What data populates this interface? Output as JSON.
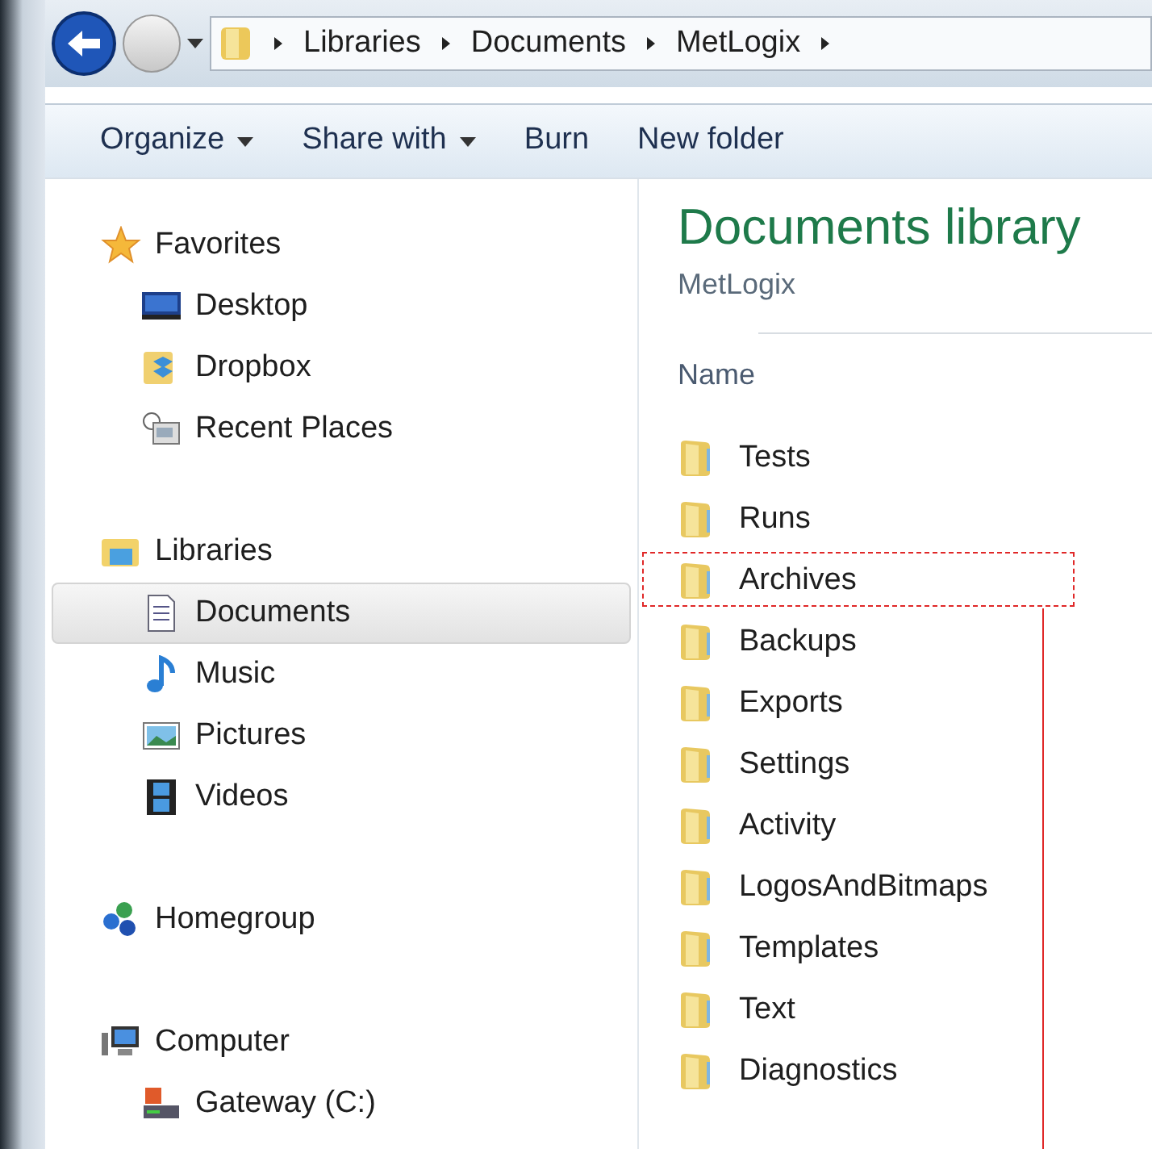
{
  "address_bar": {
    "crumbs": [
      "Libraries",
      "Documents",
      "MetLogix"
    ]
  },
  "toolbar": [
    {
      "label": "Organize",
      "dropdown": true
    },
    {
      "label": "Share with",
      "dropdown": true
    },
    {
      "label": "Burn",
      "dropdown": false
    },
    {
      "label": "New folder",
      "dropdown": false
    }
  ],
  "nav_pane": [
    {
      "label": "Favorites",
      "kind": "star",
      "children": [
        {
          "label": "Desktop",
          "kind": "desktop",
          "selected": false
        },
        {
          "label": "Dropbox",
          "kind": "dropbox",
          "selected": false
        },
        {
          "label": "Recent Places",
          "kind": "recent",
          "selected": false
        }
      ]
    },
    {
      "label": "Libraries",
      "kind": "library",
      "children": [
        {
          "label": "Documents",
          "kind": "document",
          "selected": true
        },
        {
          "label": "Music",
          "kind": "music",
          "selected": false
        },
        {
          "label": "Pictures",
          "kind": "pictures",
          "selected": false
        },
        {
          "label": "Videos",
          "kind": "videos",
          "selected": false
        }
      ]
    },
    {
      "label": "Homegroup",
      "kind": "homegroup"
    },
    {
      "label": "Computer",
      "kind": "computer",
      "children": [
        {
          "label": "Gateway (C:)",
          "kind": "drive",
          "selected": false
        }
      ]
    }
  ],
  "content": {
    "title": "Documents library",
    "subtitle": "MetLogix",
    "column": "Name",
    "files": [
      {
        "name": "Tests",
        "marked": false
      },
      {
        "name": "Runs",
        "marked": false
      },
      {
        "name": "Archives",
        "marked": true
      },
      {
        "name": "Backups",
        "marked": false
      },
      {
        "name": "Exports",
        "marked": false
      },
      {
        "name": "Settings",
        "marked": false
      },
      {
        "name": "Activity",
        "marked": false
      },
      {
        "name": "LogosAndBitmaps",
        "marked": false
      },
      {
        "name": "Templates",
        "marked": false
      },
      {
        "name": "Text",
        "marked": false
      },
      {
        "name": "Diagnostics",
        "marked": false
      }
    ]
  }
}
